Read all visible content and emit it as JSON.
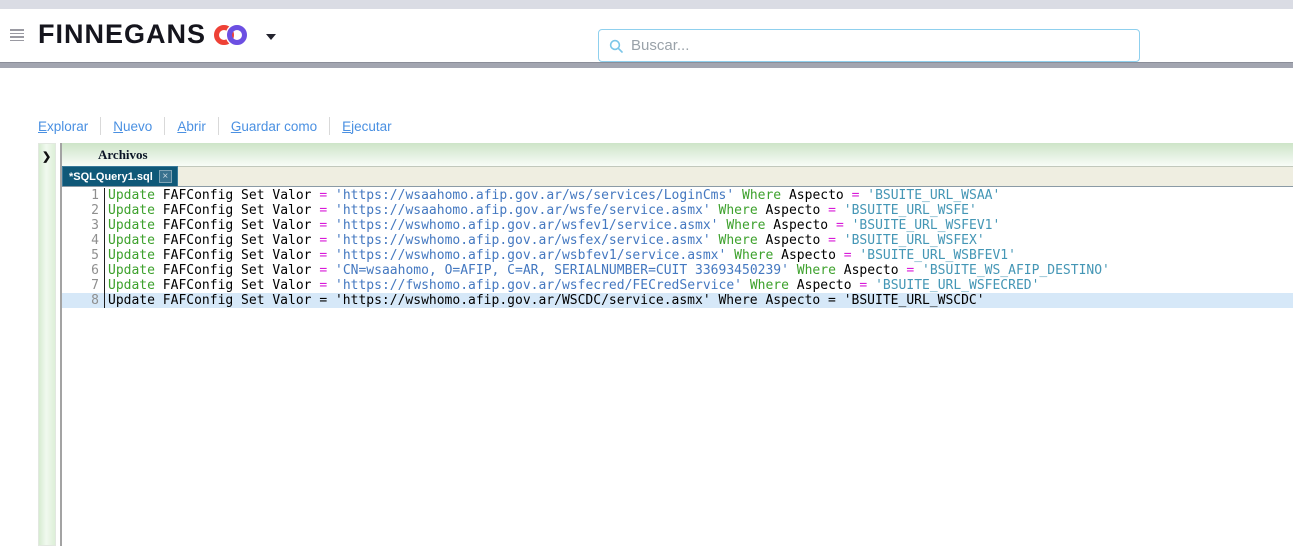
{
  "colors": {
    "keyword": "#3da12c",
    "plain": "#000000",
    "operator": "#d81ad8",
    "string_url": "#4478c0",
    "string_aspect": "#4496b5",
    "line_number": "#8f8f8f",
    "selection": "#d6e8f8",
    "tab_bg": "#0f5878",
    "accent_blue": "#4a90e2",
    "search_border": "#8fd0ee"
  },
  "header": {
    "logo_text": "FINNEGANS",
    "search": {
      "placeholder": "Buscar..."
    }
  },
  "menu": {
    "items": [
      {
        "label": "Explorar"
      },
      {
        "label": "Nuevo"
      },
      {
        "label": "Abrir"
      },
      {
        "label": "Guardar como"
      },
      {
        "label": "Ejecutar"
      }
    ]
  },
  "panel": {
    "title": "Archivos",
    "expander_glyph": "❯",
    "tab": {
      "label": "*SQLQuery1.sql",
      "close_glyph": "×"
    }
  },
  "editor": {
    "selected_line": 8,
    "lines": [
      {
        "num": 1,
        "tokens": [
          [
            "kw",
            "Update"
          ],
          [
            "pl",
            " FAFConfig Set Valor "
          ],
          [
            "op",
            "="
          ],
          [
            "pl",
            " "
          ],
          [
            "su",
            "'https://wsaahomo.afip.gov.ar/ws/services/LoginCms'"
          ],
          [
            "pl",
            " "
          ],
          [
            "kw",
            "Where"
          ],
          [
            "pl",
            " Aspecto "
          ],
          [
            "op",
            "="
          ],
          [
            "pl",
            " "
          ],
          [
            "sa",
            "'BSUITE_URL_WSAA'"
          ]
        ]
      },
      {
        "num": 2,
        "tokens": [
          [
            "kw",
            "Update"
          ],
          [
            "pl",
            " FAFConfig Set Valor "
          ],
          [
            "op",
            "="
          ],
          [
            "pl",
            " "
          ],
          [
            "su",
            "'https://wsaahomo.afip.gov.ar/wsfe/service.asmx'"
          ],
          [
            "pl",
            " "
          ],
          [
            "kw",
            "Where"
          ],
          [
            "pl",
            " Aspecto "
          ],
          [
            "op",
            "="
          ],
          [
            "pl",
            " "
          ],
          [
            "sa",
            "'BSUITE_URL_WSFE'"
          ]
        ]
      },
      {
        "num": 3,
        "tokens": [
          [
            "kw",
            "Update"
          ],
          [
            "pl",
            " FAFConfig Set Valor "
          ],
          [
            "op",
            "="
          ],
          [
            "pl",
            " "
          ],
          [
            "su",
            "'https://wswhomo.afip.gov.ar/wsfev1/service.asmx'"
          ],
          [
            "pl",
            " "
          ],
          [
            "kw",
            "Where"
          ],
          [
            "pl",
            " Aspecto "
          ],
          [
            "op",
            "="
          ],
          [
            "pl",
            " "
          ],
          [
            "sa",
            "'BSUITE_URL_WSFEV1'"
          ]
        ]
      },
      {
        "num": 4,
        "tokens": [
          [
            "kw",
            "Update"
          ],
          [
            "pl",
            " FAFConfig Set Valor "
          ],
          [
            "op",
            "="
          ],
          [
            "pl",
            " "
          ],
          [
            "su",
            "'https://wswhomo.afip.gov.ar/wsfex/service.asmx'"
          ],
          [
            "pl",
            " "
          ],
          [
            "kw",
            "Where"
          ],
          [
            "pl",
            " Aspecto "
          ],
          [
            "op",
            "="
          ],
          [
            "pl",
            " "
          ],
          [
            "sa",
            "'BSUITE_URL_WSFEX'"
          ]
        ]
      },
      {
        "num": 5,
        "tokens": [
          [
            "kw",
            "Update"
          ],
          [
            "pl",
            " FAFConfig Set Valor "
          ],
          [
            "op",
            "="
          ],
          [
            "pl",
            " "
          ],
          [
            "su",
            "'https://wswhomo.afip.gov.ar/wsbfev1/service.asmx'"
          ],
          [
            "pl",
            " "
          ],
          [
            "kw",
            "Where"
          ],
          [
            "pl",
            " Aspecto "
          ],
          [
            "op",
            "="
          ],
          [
            "pl",
            " "
          ],
          [
            "sa",
            "'BSUITE_URL_WSBFEV1'"
          ]
        ]
      },
      {
        "num": 6,
        "tokens": [
          [
            "kw",
            "Update"
          ],
          [
            "pl",
            " FAFConfig Set Valor "
          ],
          [
            "op",
            "="
          ],
          [
            "pl",
            " "
          ],
          [
            "su",
            "'CN=wsaahomo, O=AFIP, C=AR, SERIALNUMBER=CUIT 33693450239'"
          ],
          [
            "pl",
            " "
          ],
          [
            "kw",
            "Where"
          ],
          [
            "pl",
            " Aspecto "
          ],
          [
            "op",
            "="
          ],
          [
            "pl",
            " "
          ],
          [
            "sa",
            "'BSUITE_WS_AFIP_DESTINO'"
          ]
        ]
      },
      {
        "num": 7,
        "tokens": [
          [
            "kw",
            "Update"
          ],
          [
            "pl",
            " FAFConfig Set Valor "
          ],
          [
            "op",
            "="
          ],
          [
            "pl",
            " "
          ],
          [
            "su",
            "'https://fwshomo.afip.gov.ar/wsfecred/FECredService'"
          ],
          [
            "pl",
            " "
          ],
          [
            "kw",
            "Where"
          ],
          [
            "pl",
            " Aspecto "
          ],
          [
            "op",
            "="
          ],
          [
            "pl",
            " "
          ],
          [
            "sa",
            "'BSUITE_URL_WSFECRED'"
          ]
        ]
      },
      {
        "num": 8,
        "tokens": [
          [
            "pl",
            "Update FAFConfig Set Valor = 'https://wswhomo.afip.gov.ar/WSCDC/service.asmx' Where Aspecto = 'BSUITE_URL_WSCDC'"
          ]
        ]
      }
    ]
  }
}
